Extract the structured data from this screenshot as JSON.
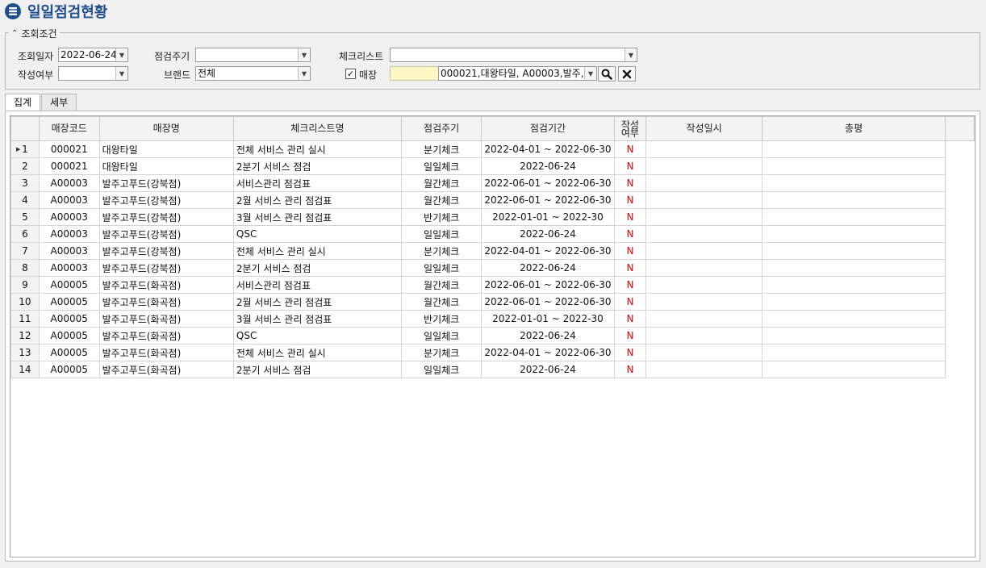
{
  "page": {
    "title": "일일점검현황"
  },
  "conditions": {
    "legend": "조회조건",
    "query_date_label": "조회일자",
    "query_date_value": "2022-06-24",
    "cycle_label": "점검주기",
    "cycle_value": "",
    "checklist_label": "체크리스트",
    "checklist_value": "",
    "written_label": "작성여부",
    "written_value": "",
    "brand_label": "브랜드",
    "brand_value": "전체",
    "store_label": "매장",
    "store_checked": true,
    "store_code_value": "",
    "store_list_value": "000021,대왕타일, A00003,발주,..."
  },
  "tabs": [
    {
      "label": "집계",
      "active": true
    },
    {
      "label": "세부",
      "active": false
    }
  ],
  "grid": {
    "columns": [
      "매장코드",
      "매장명",
      "체크리스트명",
      "점검주기",
      "점검기간",
      "작성여부",
      "작성일시",
      "총평"
    ],
    "rows": [
      {
        "no": "1",
        "code": "000021",
        "store": "대왕타일",
        "checklist": "전체 서비스 관리 실시",
        "cycle": "분기체크",
        "period": "2022-04-01 ~ 2022-06-30",
        "written": "N",
        "written_at": "",
        "review": ""
      },
      {
        "no": "2",
        "code": "000021",
        "store": "대왕타일",
        "checklist": "2분기 서비스 점검",
        "cycle": "일일체크",
        "period": "2022-06-24",
        "written": "N",
        "written_at": "",
        "review": ""
      },
      {
        "no": "3",
        "code": "A00003",
        "store": "발주고푸드(강북점)",
        "checklist": "서비스관리 점검표",
        "cycle": "월간체크",
        "period": "2022-06-01 ~ 2022-06-30",
        "written": "N",
        "written_at": "",
        "review": ""
      },
      {
        "no": "4",
        "code": "A00003",
        "store": "발주고푸드(강북점)",
        "checklist": "2월 서비스 관리 점검표",
        "cycle": "월간체크",
        "period": "2022-06-01 ~ 2022-06-30",
        "written": "N",
        "written_at": "",
        "review": ""
      },
      {
        "no": "5",
        "code": "A00003",
        "store": "발주고푸드(강북점)",
        "checklist": "3월 서비스 관리 점검표",
        "cycle": "반기체크",
        "period": "2022-01-01 ~ 2022-30",
        "written": "N",
        "written_at": "",
        "review": ""
      },
      {
        "no": "6",
        "code": "A00003",
        "store": "발주고푸드(강북점)",
        "checklist": "QSC",
        "cycle": "일일체크",
        "period": "2022-06-24",
        "written": "N",
        "written_at": "",
        "review": ""
      },
      {
        "no": "7",
        "code": "A00003",
        "store": "발주고푸드(강북점)",
        "checklist": "전체 서비스 관리 실시",
        "cycle": "분기체크",
        "period": "2022-04-01 ~ 2022-06-30",
        "written": "N",
        "written_at": "",
        "review": ""
      },
      {
        "no": "8",
        "code": "A00003",
        "store": "발주고푸드(강북점)",
        "checklist": "2분기 서비스 점검",
        "cycle": "일일체크",
        "period": "2022-06-24",
        "written": "N",
        "written_at": "",
        "review": ""
      },
      {
        "no": "9",
        "code": "A00005",
        "store": "발주고푸드(화곡점)",
        "checklist": "서비스관리 점검표",
        "cycle": "월간체크",
        "period": "2022-06-01 ~ 2022-06-30",
        "written": "N",
        "written_at": "",
        "review": ""
      },
      {
        "no": "10",
        "code": "A00005",
        "store": "발주고푸드(화곡점)",
        "checklist": "2월 서비스 관리 점검표",
        "cycle": "월간체크",
        "period": "2022-06-01 ~ 2022-06-30",
        "written": "N",
        "written_at": "",
        "review": ""
      },
      {
        "no": "11",
        "code": "A00005",
        "store": "발주고푸드(화곡점)",
        "checklist": "3월 서비스 관리 점검표",
        "cycle": "반기체크",
        "period": "2022-01-01 ~ 2022-30",
        "written": "N",
        "written_at": "",
        "review": ""
      },
      {
        "no": "12",
        "code": "A00005",
        "store": "발주고푸드(화곡점)",
        "checklist": "QSC",
        "cycle": "일일체크",
        "period": "2022-06-24",
        "written": "N",
        "written_at": "",
        "review": ""
      },
      {
        "no": "13",
        "code": "A00005",
        "store": "발주고푸드(화곡점)",
        "checklist": "전체 서비스 관리 실시",
        "cycle": "분기체크",
        "period": "2022-04-01 ~ 2022-06-30",
        "written": "N",
        "written_at": "",
        "review": ""
      },
      {
        "no": "14",
        "code": "A00005",
        "store": "발주고푸드(화곡점)",
        "checklist": "2분기 서비스 점검",
        "cycle": "일일체크",
        "period": "2022-06-24",
        "written": "N",
        "written_at": "",
        "review": ""
      }
    ]
  },
  "colors": {
    "title": "#1f4e8c",
    "flag_n": "#e00000",
    "store_code_bg": "#fff8c6"
  },
  "icons": {
    "title": "database-icon",
    "dropdown": "chevron-down-icon",
    "search": "search-icon",
    "clear": "close-icon",
    "current_row": "row-pointer-icon"
  }
}
